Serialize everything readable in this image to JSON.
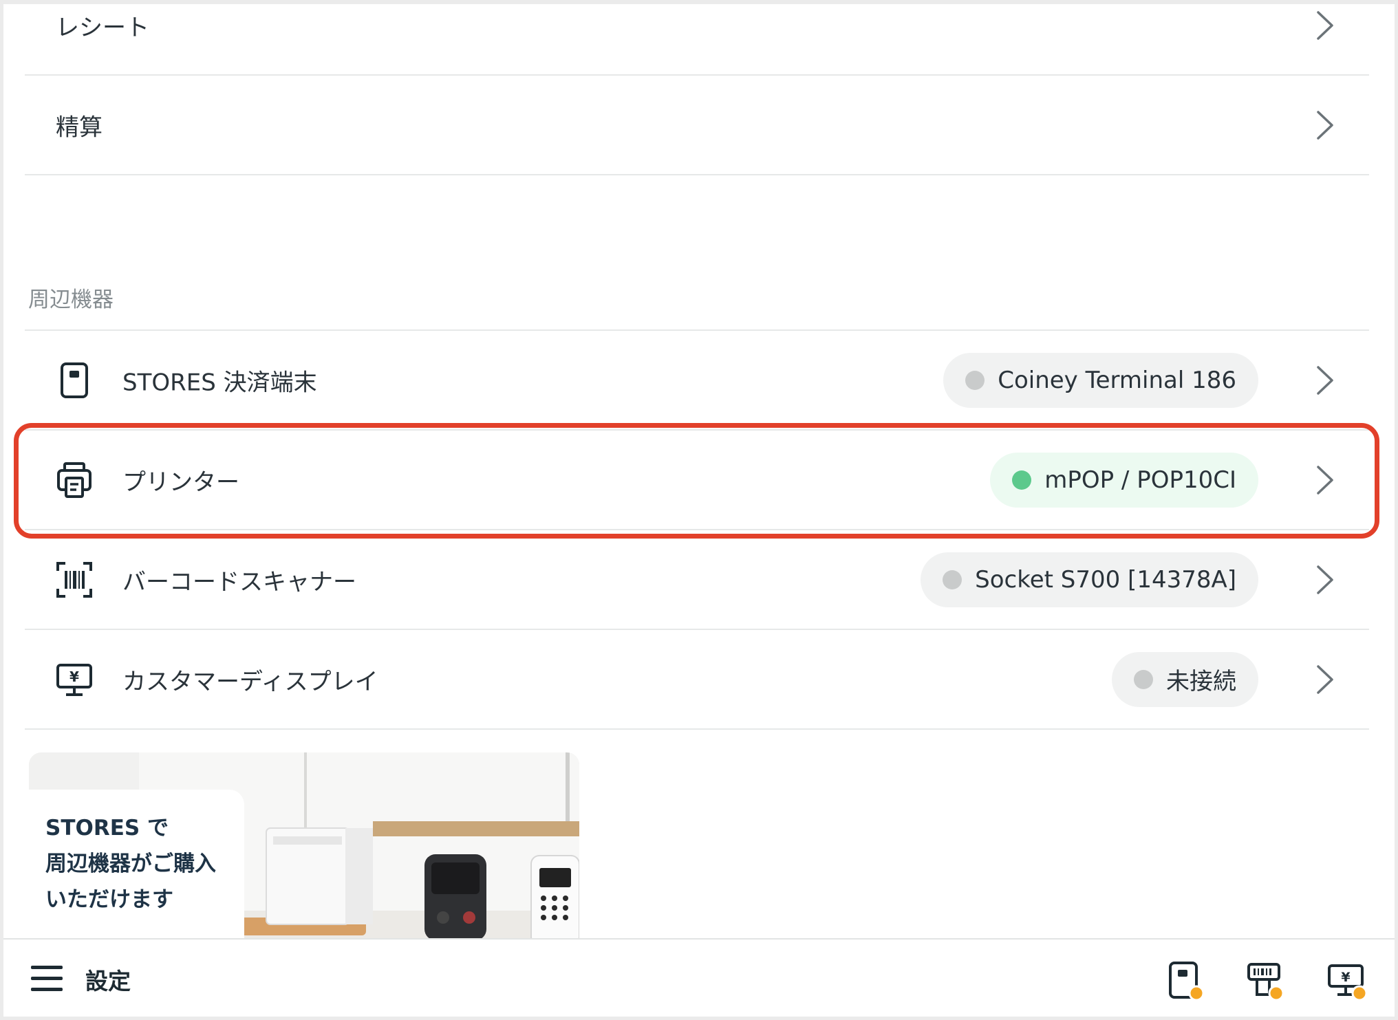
{
  "settings_list": {
    "receipt_label": "レシート",
    "settlement_label": "精算"
  },
  "peripherals": {
    "section_title": "周辺機器",
    "items": [
      {
        "label": "STORES 決済端末",
        "icon": "payment-terminal-icon",
        "status": "Coiney Terminal 186",
        "connected": false
      },
      {
        "label": "プリンター",
        "icon": "printer-icon",
        "status": "mPOP / POP10CI",
        "connected": true
      },
      {
        "label": "バーコードスキャナー",
        "icon": "barcode-scanner-icon",
        "status": "Socket S700 [14378A]",
        "connected": false
      },
      {
        "label": "カスタマーディスプレイ",
        "icon": "customer-display-icon",
        "status": "未接続",
        "connected": false
      }
    ]
  },
  "banner": {
    "line1": "STORES で",
    "line2": "周辺機器がご購入",
    "line3": "いただけます"
  },
  "bottom_bar": {
    "title": "設定",
    "status_icons": [
      "payment-terminal-status-icon",
      "printer-status-icon",
      "customer-display-status-icon"
    ]
  },
  "colors": {
    "connected_dot": "#5cc98c",
    "disconnected_dot": "#c9cbcb",
    "highlight_border": "#e2402a",
    "warning_badge": "#f5a623"
  }
}
